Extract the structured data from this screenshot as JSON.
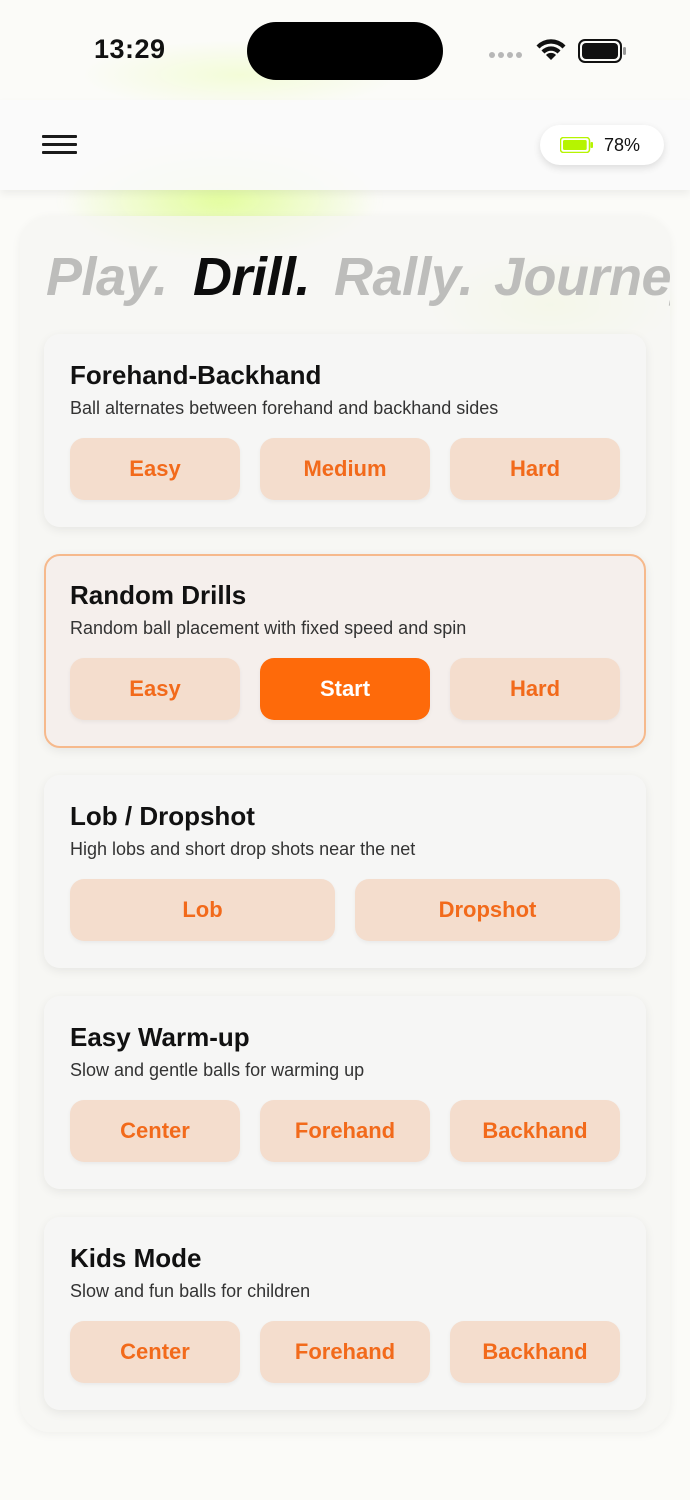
{
  "status_bar": {
    "time": "13:29"
  },
  "header": {
    "battery_percent": "78%",
    "battery_color": "#b6f400"
  },
  "tabs": [
    {
      "label": "Play."
    },
    {
      "label": "Drill."
    },
    {
      "label": "Rally."
    },
    {
      "label": "Journey"
    }
  ],
  "active_tab": "Drill.",
  "cards": [
    {
      "title": "Forehand-Backhand",
      "description": "Ball alternates between forehand and backhand sides",
      "buttons": [
        "Easy",
        "Medium",
        "Hard"
      ]
    },
    {
      "title": "Random Drills",
      "description": "Random ball placement with fixed speed and spin",
      "buttons": [
        "Easy",
        "Start",
        "Hard"
      ],
      "selected": true
    },
    {
      "title": "Lob / Dropshot",
      "description": "High lobs and short drop shots near the net",
      "buttons": [
        "Lob",
        "Dropshot"
      ]
    },
    {
      "title": "Easy Warm-up",
      "description": "Slow and gentle balls for warming up",
      "buttons": [
        "Center",
        "Forehand",
        "Backhand"
      ]
    },
    {
      "title": "Kids Mode",
      "description": "Slow and fun balls for children",
      "buttons": [
        "Center",
        "Forehand",
        "Backhand"
      ]
    }
  ],
  "colors": {
    "accent": "#fe6a0a",
    "button_bg": "#f4ddcd",
    "button_text": "#f26a1b",
    "selected_border": "#f6b98c"
  }
}
